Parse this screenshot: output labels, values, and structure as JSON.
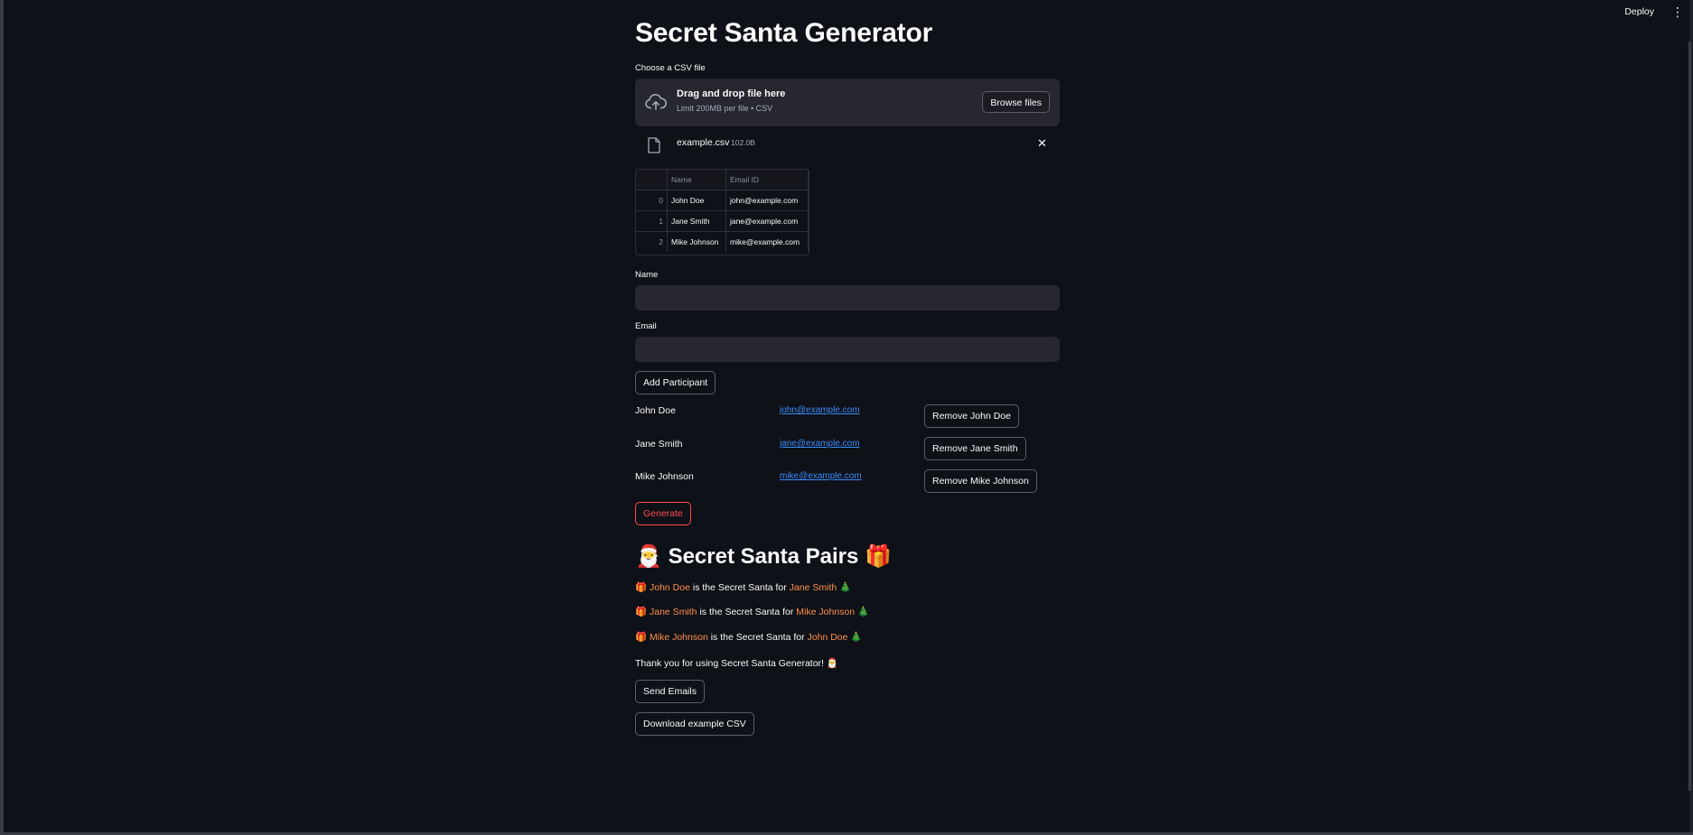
{
  "topbar": {
    "deploy_label": "Deploy",
    "menu_icon": "⋮"
  },
  "app": {
    "title": "Secret Santa Generator"
  },
  "uploader": {
    "label": "Choose a CSV file",
    "drag_title": "Drag and drop file here",
    "limit_text": "Limit 200MB per file • CSV",
    "browse_label": "Browse files",
    "icon": "cloud-upload-icon"
  },
  "uploaded_file": {
    "name": "example.csv",
    "size": "102.0B",
    "icon": "file-icon"
  },
  "dataframe": {
    "columns": [
      "",
      "Name",
      "Email ID"
    ],
    "rows": [
      {
        "index": "0",
        "name": "John Doe",
        "email": "john@example.com"
      },
      {
        "index": "1",
        "name": "Jane Smith",
        "email": "jane@example.com"
      },
      {
        "index": "2",
        "name": "Mike Johnson",
        "email": "mike@example.com"
      }
    ]
  },
  "form": {
    "name_label": "Name",
    "name_value": "",
    "email_label": "Email",
    "email_value": "",
    "add_label": "Add Participant"
  },
  "participants": [
    {
      "name": "John Doe",
      "email": "john@example.com",
      "remove_label": "Remove John Doe"
    },
    {
      "name": "Jane Smith",
      "email": "jane@example.com",
      "remove_label": "Remove Jane Smith"
    },
    {
      "name": "Mike Johnson",
      "email": "mike@example.com",
      "remove_label": "Remove Mike Johnson"
    }
  ],
  "generate_label": "Generate",
  "results": {
    "heading_emoji_left": "🎅",
    "heading": "Secret Santa Pairs",
    "heading_emoji_right": "🎁",
    "connector": "is the Secret Santa for",
    "gift_emoji": "🎁",
    "tree_emoji": "🎄",
    "pairs": [
      {
        "giver": "John Doe",
        "receiver": "Jane Smith"
      },
      {
        "giver": "Jane Smith",
        "receiver": "Mike Johnson"
      },
      {
        "giver": "Mike Johnson",
        "receiver": "John Doe"
      }
    ],
    "thanks": "Thank you for using Secret Santa Generator! 🎅"
  },
  "send_emails_label": "Send Emails",
  "download_label": "Download example CSV",
  "colors": {
    "background": "#0e1117",
    "widget_bg": "#262730",
    "primary": "#ff4b4b",
    "link": "#3d8bfd",
    "highlight": "#ff8f4d"
  }
}
